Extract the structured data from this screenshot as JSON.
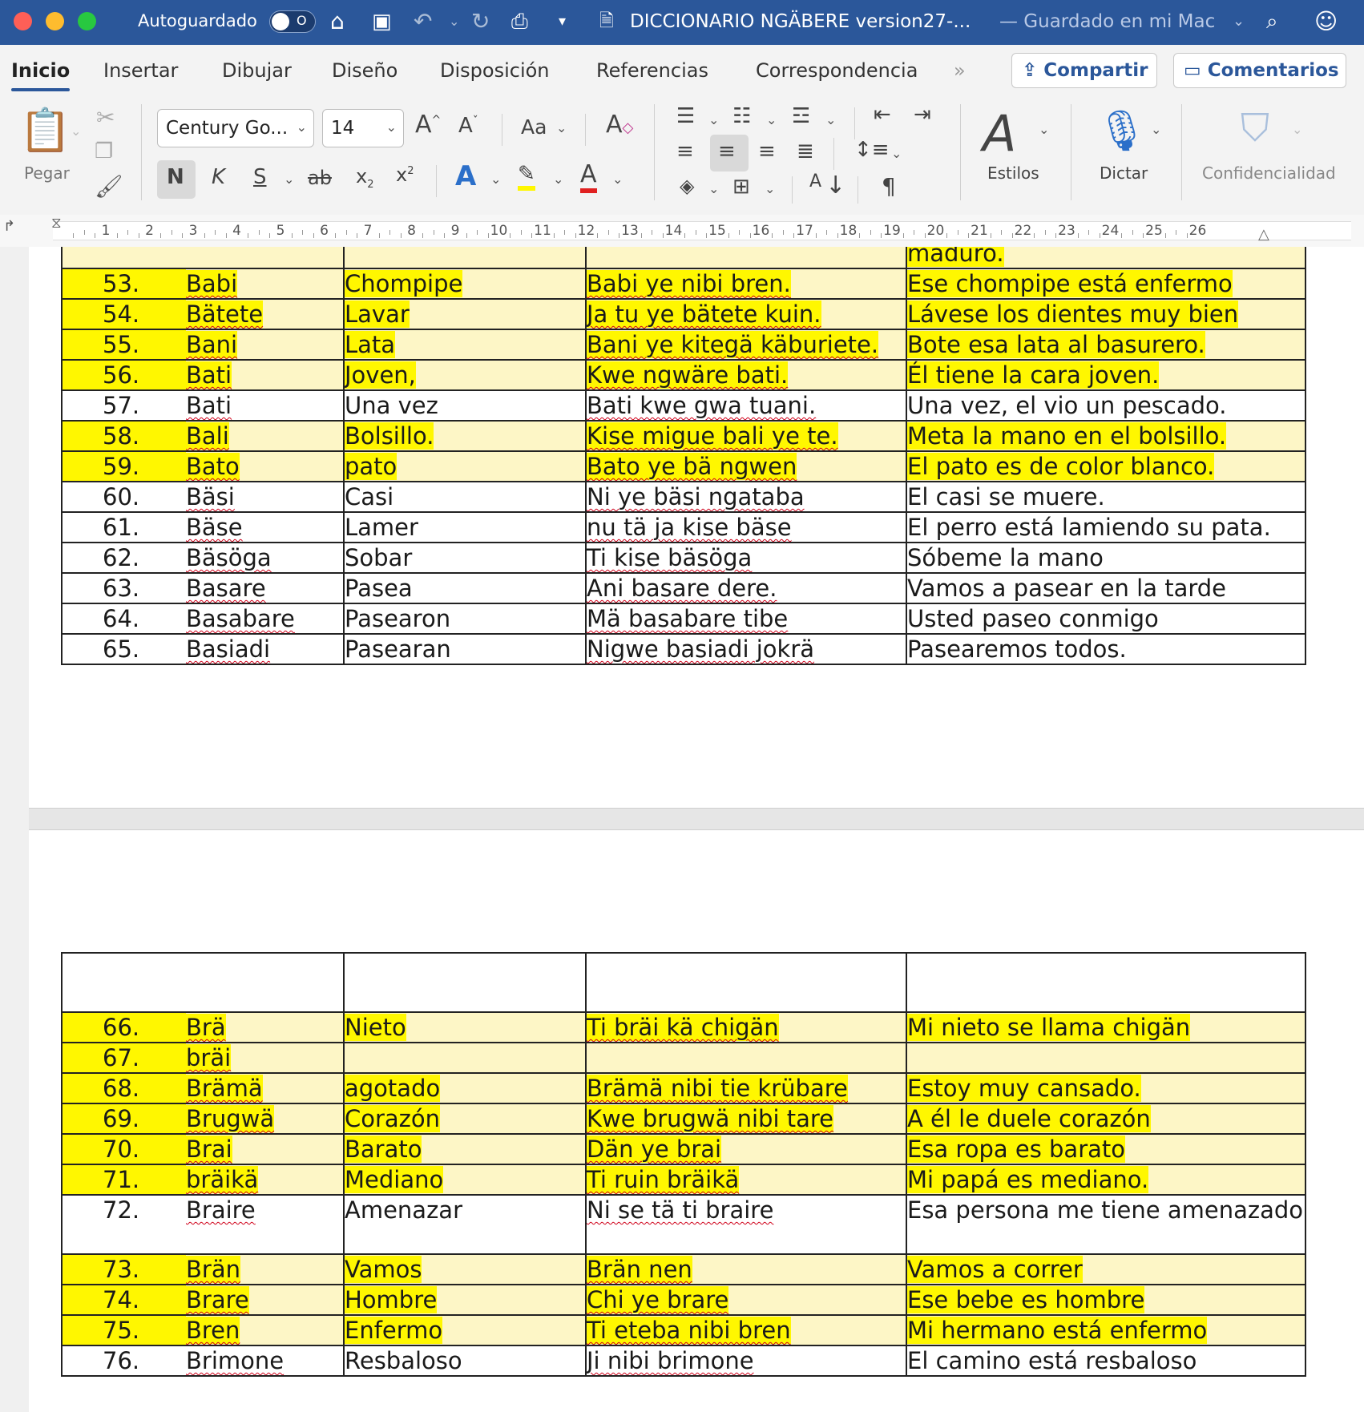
{
  "titlebar": {
    "autosave_label": "Autoguardado",
    "autosave_state": "O",
    "doc_title": "DICCIONARIO NGÄBERE version27-...",
    "save_status": "— Guardado en mi Mac"
  },
  "tabs": [
    "Inicio",
    "Insertar",
    "Dibujar",
    "Diseño",
    "Disposición",
    "Referencias",
    "Correspondencia"
  ],
  "share_label": "Compartir",
  "comments_label": "Comentarios",
  "ribbon": {
    "paste_label": "Pegar",
    "font_name": "Century Go...",
    "font_size": "14",
    "bold": "N",
    "italic": "K",
    "underline": "S",
    "strike": "ab",
    "change_case": "Aa",
    "styles_label": "Estilos",
    "dictate_label": "Dictar",
    "confidentiality_label": "Confidencialidad"
  },
  "ruler_numbers": [
    "1",
    "2",
    "3",
    "4",
    "5",
    "6",
    "7",
    "8",
    "9",
    "10",
    "11",
    "12",
    "13",
    "14",
    "15",
    "16",
    "17",
    "18",
    "19",
    "20",
    "21",
    "22",
    "23",
    "24",
    "25",
    "26"
  ],
  "top_table": {
    "first_row": {
      "c4": "maduro."
    },
    "rows": [
      {
        "n": "53.",
        "word": "Babi",
        "es": "Chompipe",
        "ex": "Babi ye nibi bren.",
        "tr": "Ese chompipe está enfermo",
        "hl": true
      },
      {
        "n": "54.",
        "word": "Bätete",
        "es": "Lavar",
        "ex": "Ja tu ye bätete kuin.",
        "tr": "Lávese los dientes muy bien",
        "hl": true
      },
      {
        "n": "55.",
        "word": "Bani",
        "es": "Lata",
        "ex": "Bani ye kitegä käburiete.",
        "tr": "Bote esa lata al basurero.",
        "hl": true
      },
      {
        "n": "56.",
        "word": "Bati",
        "es": " Joven,",
        "ex": "Kwe ngwäre bati.",
        "tr": "Él tiene la cara joven.",
        "hl": true
      },
      {
        "n": "57.",
        "word": "Bati",
        "es": "Una vez",
        "ex": "Bati kwe gwa tuani.",
        "tr": "Una vez, el vio un pescado.",
        "hl": false
      },
      {
        "n": "58.",
        "word": "Bali",
        "es": "Bolsillo.",
        "ex": "Kise migue bali ye te.",
        "tr": "Meta la mano en el bolsillo.",
        "hl": true
      },
      {
        "n": "59.",
        "word": "Bato",
        "es": "pato",
        "ex": "Bato ye bä ngwen",
        "tr": "El pato es de color blanco.",
        "hl": true
      },
      {
        "n": "60.",
        "word": "Bäsi",
        "es": "Casi",
        "ex": "Ni ye bäsi ngataba",
        "tr": "El casi se muere.",
        "hl": false
      },
      {
        "n": "61.",
        "word": "Bäse",
        "es": "Lamer",
        "ex": "nu tä ja kise bäse",
        "tr": "El perro está lamiendo su pata.",
        "hl": false
      },
      {
        "n": "62.",
        "word": "Bäsöga",
        "es": "Sobar",
        "ex": "Ti kise bäsöga",
        "tr": "Sóbeme la mano",
        "hl": false
      },
      {
        "n": "63.",
        "word": "Basare",
        "es": "Pasea",
        "ex": "Ani basare dere.",
        "tr": "Vamos a pasear en la tarde",
        "hl": false
      },
      {
        "n": "64.",
        "word": "Basabare",
        "es": "Pasearon",
        "ex": "Mä basabare tibe",
        "tr": "Usted paseo  conmigo",
        "hl": false
      },
      {
        "n": "65.",
        "word": "Basiadi",
        "es": "Pasearan",
        "ex": "Nigwe basiadi jokrä",
        "tr": "Pasearemos todos.",
        "hl": false
      }
    ]
  },
  "bottom_table": {
    "rows": [
      {
        "n": "66.",
        "word": "Brä",
        "es": "Nieto",
        "ex": "Ti bräi kä chigän",
        "tr": "Mi nieto se llama chigän",
        "hl": true
      },
      {
        "n": "67.",
        "word": "bräi",
        "es": "",
        "ex": "",
        "tr": "",
        "hl": true
      },
      {
        "n": "68.",
        "word": "Brämä",
        "es": "agotado",
        "ex": "Brämä nibi tie krübare",
        "tr": "Estoy muy cansado.",
        "hl": true
      },
      {
        "n": "69.",
        "word": "Brugwä",
        "es": "Corazón",
        "ex": "Kwe brugwä nibi tare",
        "tr": "A él le duele corazón",
        "hl": true
      },
      {
        "n": "70.",
        "word": "Brai",
        "es": "Barato",
        "ex": "Dän ye brai",
        "tr": "Esa ropa es barato",
        "hl": true
      },
      {
        "n": "71.",
        "word": "bräikä",
        "es": "Mediano",
        "ex": "Ti ruin bräikä",
        "tr": "Mi papá es mediano.",
        "hl": true
      },
      {
        "n": "72.",
        "word": "Braire",
        "es": "Amenazar",
        "ex": "Ni se tä ti braire",
        "tr": "Esa persona me tiene amenazado",
        "hl": false
      },
      {
        "n": "73.",
        "word": "Brän",
        "es": "Vamos",
        "ex": "Brän nen",
        "tr": "Vamos a correr",
        "hl": true
      },
      {
        "n": "74.",
        "word": "Brare",
        "es": "Hombre",
        "ex": "Chi ye brare",
        "tr": "Ese bebe es hombre",
        "hl": true
      },
      {
        "n": "75.",
        "word": "Bren",
        "es": "Enfermo",
        "ex": "Ti eteba nibi bren",
        "tr": "Mi hermano está enfermo",
        "hl": true
      },
      {
        "n": "76.",
        "word": "Brimone",
        "es": "Resbaloso",
        "ex": "Ji nibi brimone",
        "tr": "El camino está resbaloso",
        "hl": false
      }
    ]
  }
}
